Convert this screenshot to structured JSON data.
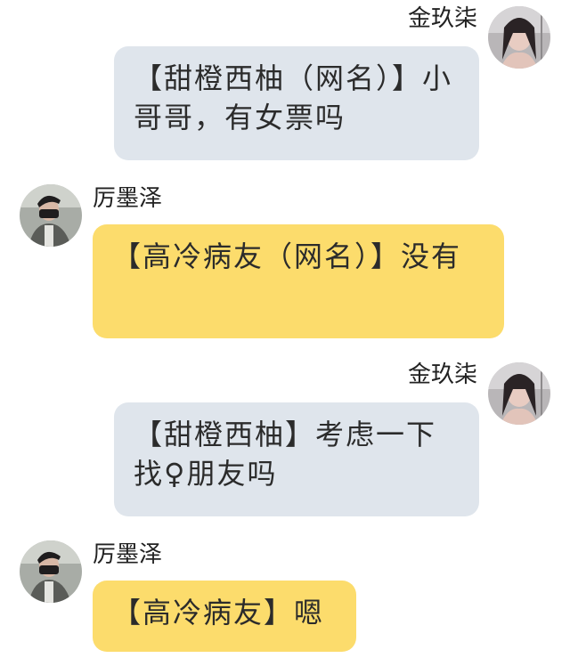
{
  "conversation": {
    "messages": [
      {
        "sender": "金玖柒",
        "side": "right",
        "text": "【甜橙西柚（网名）】小哥哥，有女票吗"
      },
      {
        "sender": "厉墨泽",
        "side": "left",
        "text": "【高冷病友（网名）】没有"
      },
      {
        "sender": "金玖柒",
        "side": "right",
        "text": "【甜橙西柚】考虑一下找♀朋友吗"
      },
      {
        "sender": "厉墨泽",
        "side": "left",
        "text": "【高冷病友】嗯"
      }
    ]
  },
  "colors": {
    "bubble_gray": "#dfe5ec",
    "bubble_yellow": "#fcdc6c",
    "background": "#ffffff"
  },
  "icons": {
    "female_avatar": "avatar-female-icon",
    "male_avatar": "avatar-male-icon"
  }
}
